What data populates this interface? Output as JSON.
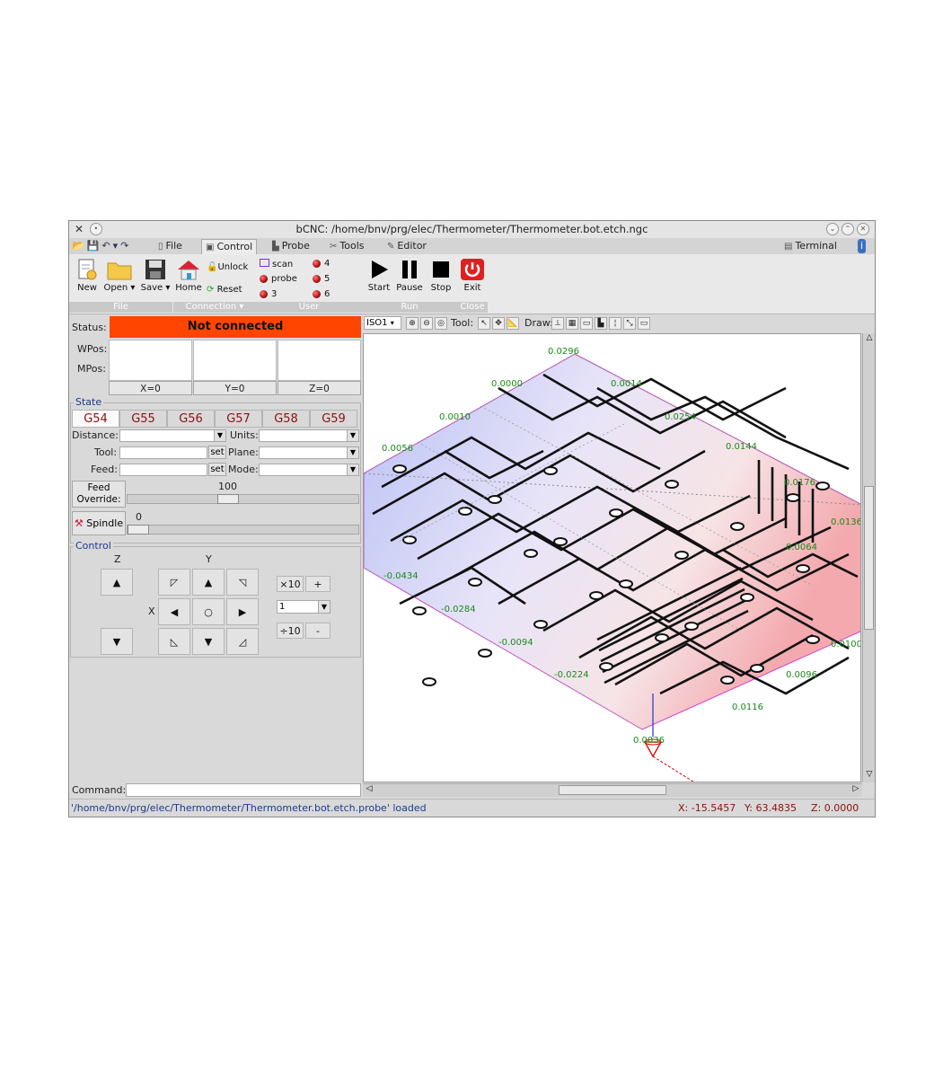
{
  "window": {
    "title": "bCNC: /home/bnv/prg/elec/Thermometer/Thermometer.bot.etch.ngc"
  },
  "tabs": [
    {
      "label": "File",
      "icon": "file-icon"
    },
    {
      "label": "Control",
      "icon": "control-icon"
    },
    {
      "label": "Probe",
      "icon": "probe-icon"
    },
    {
      "label": "Tools",
      "icon": "tools-icon"
    },
    {
      "label": "Editor",
      "icon": "editor-icon"
    }
  ],
  "terminal_label": "Terminal",
  "ribbon": {
    "file": {
      "new": "New",
      "open": "Open",
      "save": "Save",
      "group": "File"
    },
    "connection": {
      "home": "Home",
      "unlock": "Unlock",
      "reset": "Reset",
      "group": "Connection"
    },
    "user": {
      "scan": "scan",
      "probe": "probe",
      "b3": "3",
      "b4": "4",
      "b5": "5",
      "b6": "6",
      "group": "User"
    },
    "run": {
      "start": "Start",
      "pause": "Pause",
      "stop": "Stop",
      "group": "Run"
    },
    "close": {
      "exit": "Exit",
      "group": "Close"
    }
  },
  "status": {
    "label": "Status:",
    "value": "Not connected",
    "wpos_label": "WPos:",
    "mpos_label": "MPos:",
    "zero_x": "X=0",
    "zero_y": "Y=0",
    "zero_z": "Z=0"
  },
  "state": {
    "title": "State",
    "gcodes": [
      "G54",
      "G55",
      "G56",
      "G57",
      "G58",
      "G59"
    ],
    "distance_label": "Distance:",
    "units_label": "Units:",
    "tool_label": "Tool:",
    "plane_label": "Plane:",
    "feed_label": "Feed:",
    "mode_label": "Mode:",
    "set_label": "set",
    "feed_override_label_1": "Feed",
    "feed_override_label_2": "Override:",
    "feed_override_value": "100",
    "spindle_label": "Spindle",
    "spindle_value": "0"
  },
  "control": {
    "title": "Control",
    "z_label": "Z",
    "y_label": "Y",
    "x_label": "X",
    "times10": "×10",
    "div10": "÷10",
    "plus": "+",
    "minus": "-",
    "step": "1"
  },
  "canvas_toolbar": {
    "view": "ISO1",
    "tool_label": "Tool:",
    "draw_label": "Draw:"
  },
  "probe_labels": [
    "0.0296",
    "0.0014",
    "0.0000",
    "0.0254",
    "0.0144",
    "0.0176",
    "-0.0434",
    "-0.0284",
    "-0.0094",
    "-0.0224",
    "0.0096",
    "0.0116",
    "0.0136",
    "0.0100",
    "0.0056",
    "0.0036",
    "0.0064",
    "0.0010"
  ],
  "command_label": "Command:",
  "statusbar": {
    "message": "'/home/bnv/prg/elec/Thermometer/Thermometer.bot.etch.probe' loaded",
    "x": "X: -15.5457",
    "y": "Y: 63.4835",
    "z": "Z: 0.0000"
  }
}
